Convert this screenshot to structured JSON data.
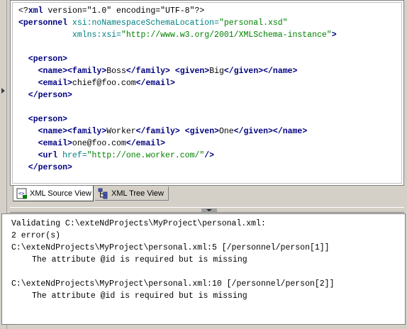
{
  "editor": {
    "lines": [
      [
        {
          "t": "<?",
          "c": "t-pi"
        },
        {
          "t": "xml",
          "c": "t-tag"
        },
        {
          "t": " version=\"1.0\" encoding=\"UTF-8\"",
          "c": "t-pi"
        },
        {
          "t": "?>",
          "c": "t-pi"
        }
      ],
      [
        {
          "t": "<personnel",
          "c": "t-tag"
        },
        {
          "t": " xsi:noNamespaceSchemaLocation=",
          "c": "t-attr"
        },
        {
          "t": "\"personal.xsd\"",
          "c": "t-val"
        }
      ],
      [
        {
          "t": "           xmlns:xsi=",
          "c": "t-attr"
        },
        {
          "t": "\"http://www.w3.org/2001/XMLSchema-instance\"",
          "c": "t-val"
        },
        {
          "t": ">",
          "c": "t-tag"
        }
      ],
      [],
      [
        {
          "t": "  <person>",
          "c": "t-tag"
        }
      ],
      [
        {
          "t": "    <name><family>",
          "c": "t-tag"
        },
        {
          "t": "Boss",
          "c": "t-text"
        },
        {
          "t": "</family>",
          "c": "t-tag"
        },
        {
          "t": " ",
          "c": "t-text"
        },
        {
          "t": "<given>",
          "c": "t-tag"
        },
        {
          "t": "Big",
          "c": "t-text"
        },
        {
          "t": "</given></name>",
          "c": "t-tag"
        }
      ],
      [
        {
          "t": "    <email>",
          "c": "t-tag"
        },
        {
          "t": "chief@foo.com",
          "c": "t-text"
        },
        {
          "t": "</email>",
          "c": "t-tag"
        }
      ],
      [
        {
          "t": "  </person>",
          "c": "t-tag"
        }
      ],
      [],
      [
        {
          "t": "  <person>",
          "c": "t-tag"
        }
      ],
      [
        {
          "t": "    <name><family>",
          "c": "t-tag"
        },
        {
          "t": "Worker",
          "c": "t-text"
        },
        {
          "t": "</family>",
          "c": "t-tag"
        },
        {
          "t": " ",
          "c": "t-text"
        },
        {
          "t": "<given>",
          "c": "t-tag"
        },
        {
          "t": "One",
          "c": "t-text"
        },
        {
          "t": "</given></name>",
          "c": "t-tag"
        }
      ],
      [
        {
          "t": "    <email>",
          "c": "t-tag"
        },
        {
          "t": "one@foo.com",
          "c": "t-text"
        },
        {
          "t": "</email>",
          "c": "t-tag"
        }
      ],
      [
        {
          "t": "    <url",
          "c": "t-tag"
        },
        {
          "t": " href=",
          "c": "t-attr"
        },
        {
          "t": "\"http://one.worker.com/\"",
          "c": "t-val"
        },
        {
          "t": "/>",
          "c": "t-tag"
        }
      ],
      [
        {
          "t": "  </person>",
          "c": "t-tag"
        }
      ]
    ]
  },
  "tabs": {
    "source_label": "XML Source View",
    "tree_label": "XML Tree View"
  },
  "console": {
    "lines": [
      "Validating C:\\exteNdProjects\\MyProject\\personal.xml:",
      "2 error(s)",
      "C:\\exteNdProjects\\MyProject\\personal.xml:5 [/personnel/person[1]]",
      "The attribute @id is required but is missing",
      "",
      "C:\\exteNdProjects\\MyProject\\personal.xml:10 [/personnel/person[2]]",
      "The attribute @id is required but is missing"
    ]
  },
  "colors": {
    "tag": "#000080",
    "attribute": "#008080",
    "value": "#008000",
    "chrome": "#d4d0c8"
  },
  "icons": {
    "source_tab": "xml-source-icon",
    "tree_tab": "xml-tree-icon"
  }
}
